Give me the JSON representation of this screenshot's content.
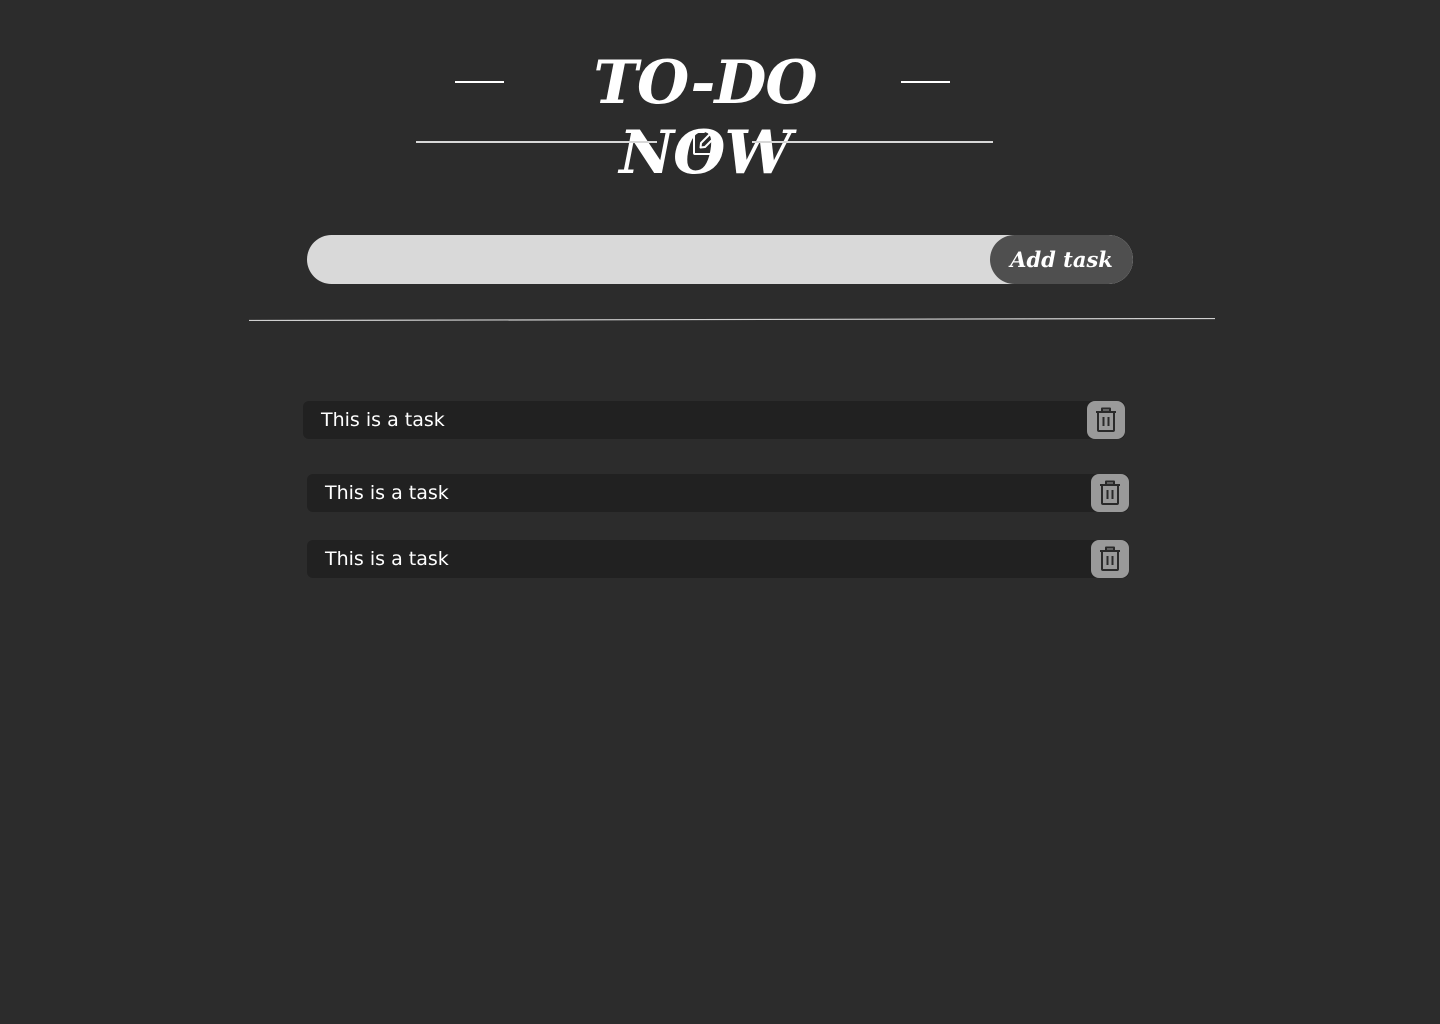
{
  "header": {
    "title": "TO-DO NOW",
    "icon": "edit-icon"
  },
  "add_task": {
    "input_value": "",
    "input_placeholder": "",
    "button_label": "Add task"
  },
  "tasks": [
    {
      "label": "This is a task",
      "icon": "trash-icon"
    },
    {
      "label": "This is a task",
      "icon": "trash-icon"
    },
    {
      "label": "This is a task",
      "icon": "trash-icon"
    }
  ],
  "colors": {
    "background": "#2c2c2c",
    "input_background": "#d9d9d9",
    "button_background": "#4f4f4f",
    "task_background": "#212121",
    "delete_button_background": "#9a9a9a",
    "text": "#ffffff"
  }
}
